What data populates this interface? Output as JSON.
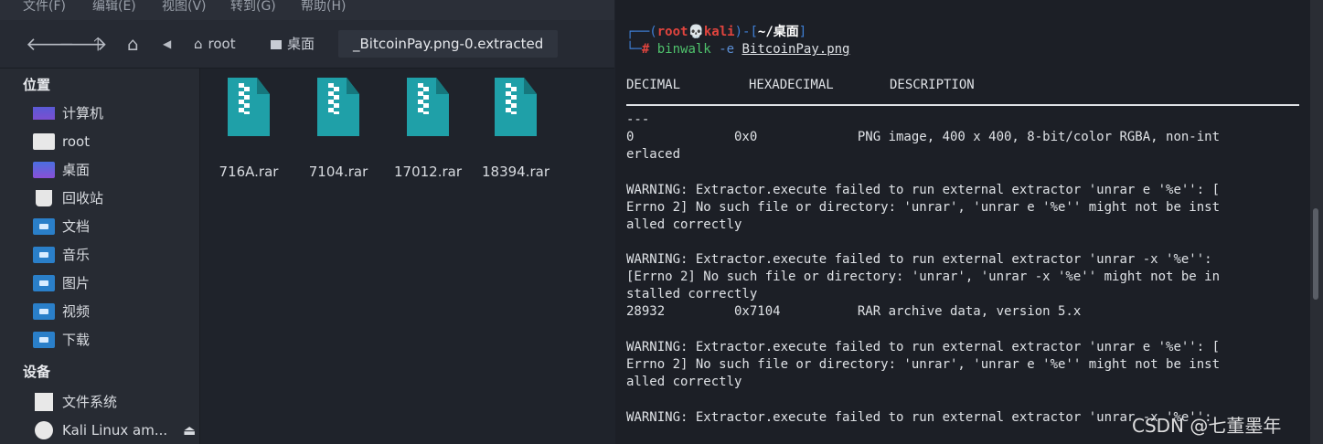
{
  "menubar": {
    "items": [
      "文件(F)",
      "编辑(E)",
      "视图(V)",
      "转到(G)",
      "帮助(H)"
    ]
  },
  "toolbar": {
    "icons": [
      "back-arrow-icon",
      "forward-arrow-icon",
      "up-arrow-icon",
      "home-icon",
      "breadcrumb-left-icon"
    ],
    "breadcrumbs": [
      "root",
      "桌面",
      "_BitcoinPay.png-0.extracted"
    ]
  },
  "sidebar": {
    "places_title": "位置",
    "places": [
      "计算机",
      "root",
      "桌面",
      "回收站",
      "文档",
      "音乐",
      "图片",
      "视频",
      "下载"
    ],
    "devices_title": "设备",
    "devices": [
      "文件系统",
      "Kali Linux am..."
    ],
    "eject_glyph": "⏏"
  },
  "files": [
    {
      "name": "716A.rar",
      "icon": "archive-icon"
    },
    {
      "name": "7104.rar",
      "icon": "archive-icon"
    },
    {
      "name": "17012.rar",
      "icon": "archive-icon"
    },
    {
      "name": "18394.rar",
      "icon": "archive-icon"
    }
  ],
  "terminal": {
    "prompt": {
      "line1_start": "┌──(",
      "user": "root",
      "skull": "💀",
      "host": "kali",
      "mid": ")-[",
      "path": "~/桌面",
      "end": "]",
      "line2_start": "└─",
      "hash": "#",
      "command": "binwalk",
      "flag": "-e",
      "argument": "BitcoinPay.png"
    },
    "headers": [
      "DECIMAL",
      "HEXADECIMAL",
      "DESCRIPTION"
    ],
    "dashes": "---",
    "lines": [
      "0             0x0             PNG image, 400 x 400, 8-bit/color RGBA, non-int",
      "erlaced",
      "WARNING: Extractor.execute failed to run external extractor 'unrar e '%e'': [",
      "Errno 2] No such file or directory: 'unrar', 'unrar e '%e'' might not be inst",
      "alled correctly",
      "WARNING: Extractor.execute failed to run external extractor 'unrar -x '%e'':",
      "[Errno 2] No such file or directory: 'unrar', 'unrar -x '%e'' might not be in",
      "stalled correctly",
      "28932         0x7104          RAR archive data, version 5.x",
      "WARNING: Extractor.execute failed to run external extractor 'unrar e '%e'': [",
      "Errno 2] No such file or directory: 'unrar', 'unrar e '%e'' might not be inst",
      "alled correctly",
      "WARNING: Extractor.execute failed to run external extractor 'unrar -x '%e'':"
    ]
  },
  "watermark": "CSDN @七董墨年",
  "colors": {
    "accent": "#1fa0a8",
    "folder": "#2a7fc9",
    "prompt_red": "#e0443e",
    "cmd_green": "#4fc26c"
  }
}
